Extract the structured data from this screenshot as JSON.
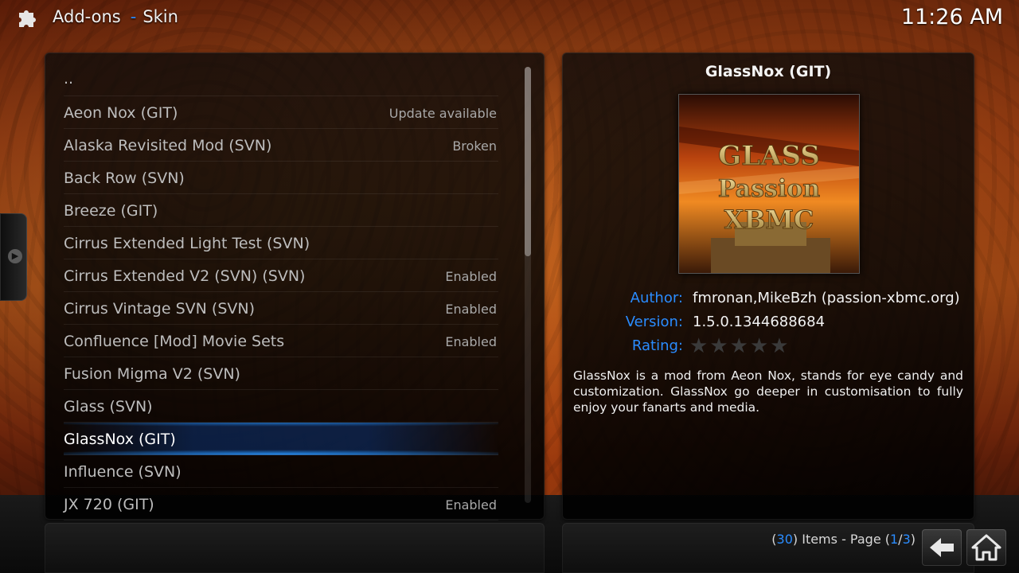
{
  "header": {
    "section": "Add-ons",
    "separator": "-",
    "subsection": "Skin",
    "clock": "11:26 AM"
  },
  "list": {
    "parent_label": "..",
    "items": [
      {
        "name": "Aeon Nox (GIT)",
        "status": "Update available"
      },
      {
        "name": "Alaska Revisited Mod (SVN)",
        "status": "Broken"
      },
      {
        "name": "Back Row (SVN)",
        "status": ""
      },
      {
        "name": "Breeze (GIT)",
        "status": ""
      },
      {
        "name": "Cirrus Extended Light Test (SVN)",
        "status": ""
      },
      {
        "name": "Cirrus Extended V2 (SVN) (SVN)",
        "status": "Enabled"
      },
      {
        "name": "Cirrus Vintage SVN (SVN)",
        "status": "Enabled"
      },
      {
        "name": "Confluence [Mod] Movie Sets",
        "status": "Enabled"
      },
      {
        "name": "Fusion Migma V2 (SVN)",
        "status": ""
      },
      {
        "name": "Glass (SVN)",
        "status": ""
      },
      {
        "name": "GlassNox (GIT)",
        "status": ""
      },
      {
        "name": "Influence (SVN)",
        "status": ""
      },
      {
        "name": "JX 720 (GIT)",
        "status": "Enabled"
      }
    ],
    "selected_index": 10
  },
  "details": {
    "title": "GlassNox (GIT)",
    "thumbnail_text": [
      "GLASS",
      "Passion",
      "XBMC"
    ],
    "author_label": "Author:",
    "author": "fmronan,MikeBzh (passion-xbmc.org)",
    "version_label": "Version:",
    "version": "1.5.0.1344688684",
    "rating_label": "Rating:",
    "rating": 0,
    "rating_max": 5,
    "description": "GlassNox is a mod from Aeon Nox, stands for eye candy and customization. GlassNox go deeper in customisation to fully enjoy your fanarts and media."
  },
  "footer": {
    "open_paren": "(",
    "items_count": "30",
    "items_text": ") Items - Page (",
    "page_current": "1",
    "page_sep": "/",
    "page_total": "3",
    "close_paren": ")"
  },
  "icons": {
    "addons": "puzzle-icon",
    "back": "back-arrow-icon",
    "home": "home-icon",
    "side": "chevron-right-icon"
  },
  "colors": {
    "accent": "#2a8cff",
    "selection_glow": "#2896ff"
  }
}
